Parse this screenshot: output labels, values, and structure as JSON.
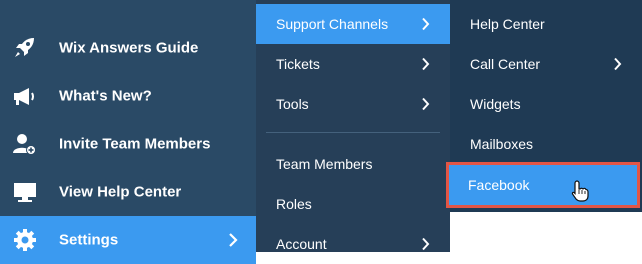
{
  "nav": {
    "items": [
      {
        "label": "Wix Answers Guide",
        "icon": "rocket-icon"
      },
      {
        "label": "What's New?",
        "icon": "megaphone-icon"
      },
      {
        "label": "Invite Team Members",
        "icon": "add-user-icon"
      },
      {
        "label": "View Help Center",
        "icon": "monitor-icon"
      },
      {
        "label": "Settings",
        "icon": "gear-icon",
        "active": true
      }
    ]
  },
  "settings_menu": {
    "items": [
      {
        "label": "Support Channels",
        "has_submenu": true,
        "active": true
      },
      {
        "label": "Tickets",
        "has_submenu": true
      },
      {
        "label": "Tools",
        "has_submenu": true
      },
      {
        "label": "Team Members",
        "has_submenu": false
      },
      {
        "label": "Roles",
        "has_submenu": false
      },
      {
        "label": "Account",
        "has_submenu": true
      }
    ]
  },
  "support_menu": {
    "items": [
      {
        "label": "Help Center",
        "has_submenu": false
      },
      {
        "label": "Call Center",
        "has_submenu": true
      },
      {
        "label": "Widgets",
        "has_submenu": false
      },
      {
        "label": "Mailboxes",
        "has_submenu": false
      },
      {
        "label": "Facebook",
        "has_submenu": false,
        "active": true
      }
    ]
  },
  "colors": {
    "nav_bg": "#2a4a66",
    "submenu_bg": "#263f58",
    "subsubmenu_bg": "#1f3a54",
    "accent": "#3b9af0",
    "highlight_border": "#e25545"
  }
}
